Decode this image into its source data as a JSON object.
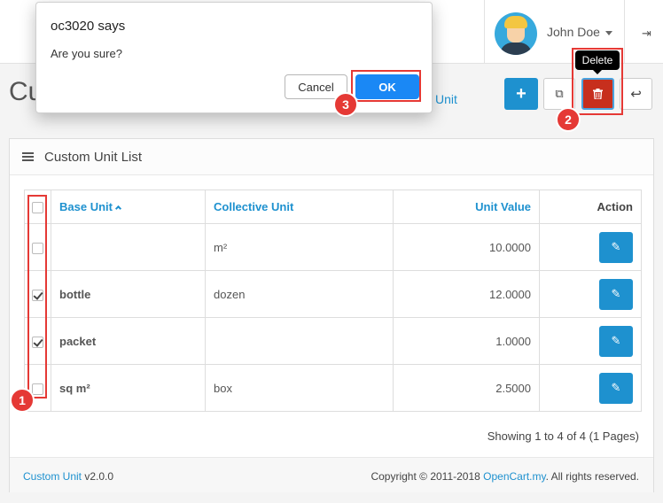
{
  "header": {
    "user_name": "John Doe"
  },
  "page": {
    "title_visible": "Cus",
    "breadcrumb_visible": "Unit"
  },
  "toolbar": {
    "add_glyph": "+",
    "copy_glyph": "⧉",
    "delete_glyph": "🗑",
    "back_glyph": "↩",
    "delete_tooltip": "Delete"
  },
  "panel": {
    "title": "Custom Unit List"
  },
  "table": {
    "headers": {
      "base_unit": "Base Unit",
      "collective_unit": "Collective Unit",
      "unit_value": "Unit Value",
      "action": "Action"
    },
    "rows": [
      {
        "base_unit": "",
        "collective_unit": "m²",
        "unit_value": "10.0000",
        "checked": false
      },
      {
        "base_unit": "bottle",
        "collective_unit": "dozen",
        "unit_value": "12.0000",
        "checked": true
      },
      {
        "base_unit": "packet",
        "collective_unit": "",
        "unit_value": "1.0000",
        "checked": true
      },
      {
        "base_unit": "sq m²",
        "collective_unit": "box",
        "unit_value": "2.5000",
        "checked": false
      }
    ]
  },
  "pagination": {
    "info": "Showing 1 to 4 of 4 (1 Pages)"
  },
  "footer": {
    "module_link": "Custom Unit",
    "module_version": " v2.0.0",
    "copyright_prefix": "Copyright © 2011-2018 ",
    "copyright_link": "OpenCart.my",
    "copyright_suffix": ". All rights reserved."
  },
  "dialog": {
    "title": "oc3020 says",
    "message": "Are you sure?",
    "cancel_label": "Cancel",
    "ok_label": "OK"
  },
  "annotations": {
    "step1": "1",
    "step2": "2",
    "step3": "3"
  },
  "colors": {
    "primary": "#1e91cf",
    "danger": "#c72f1d",
    "highlight": "#e53935",
    "dialog_ok": "#1a88f5"
  }
}
